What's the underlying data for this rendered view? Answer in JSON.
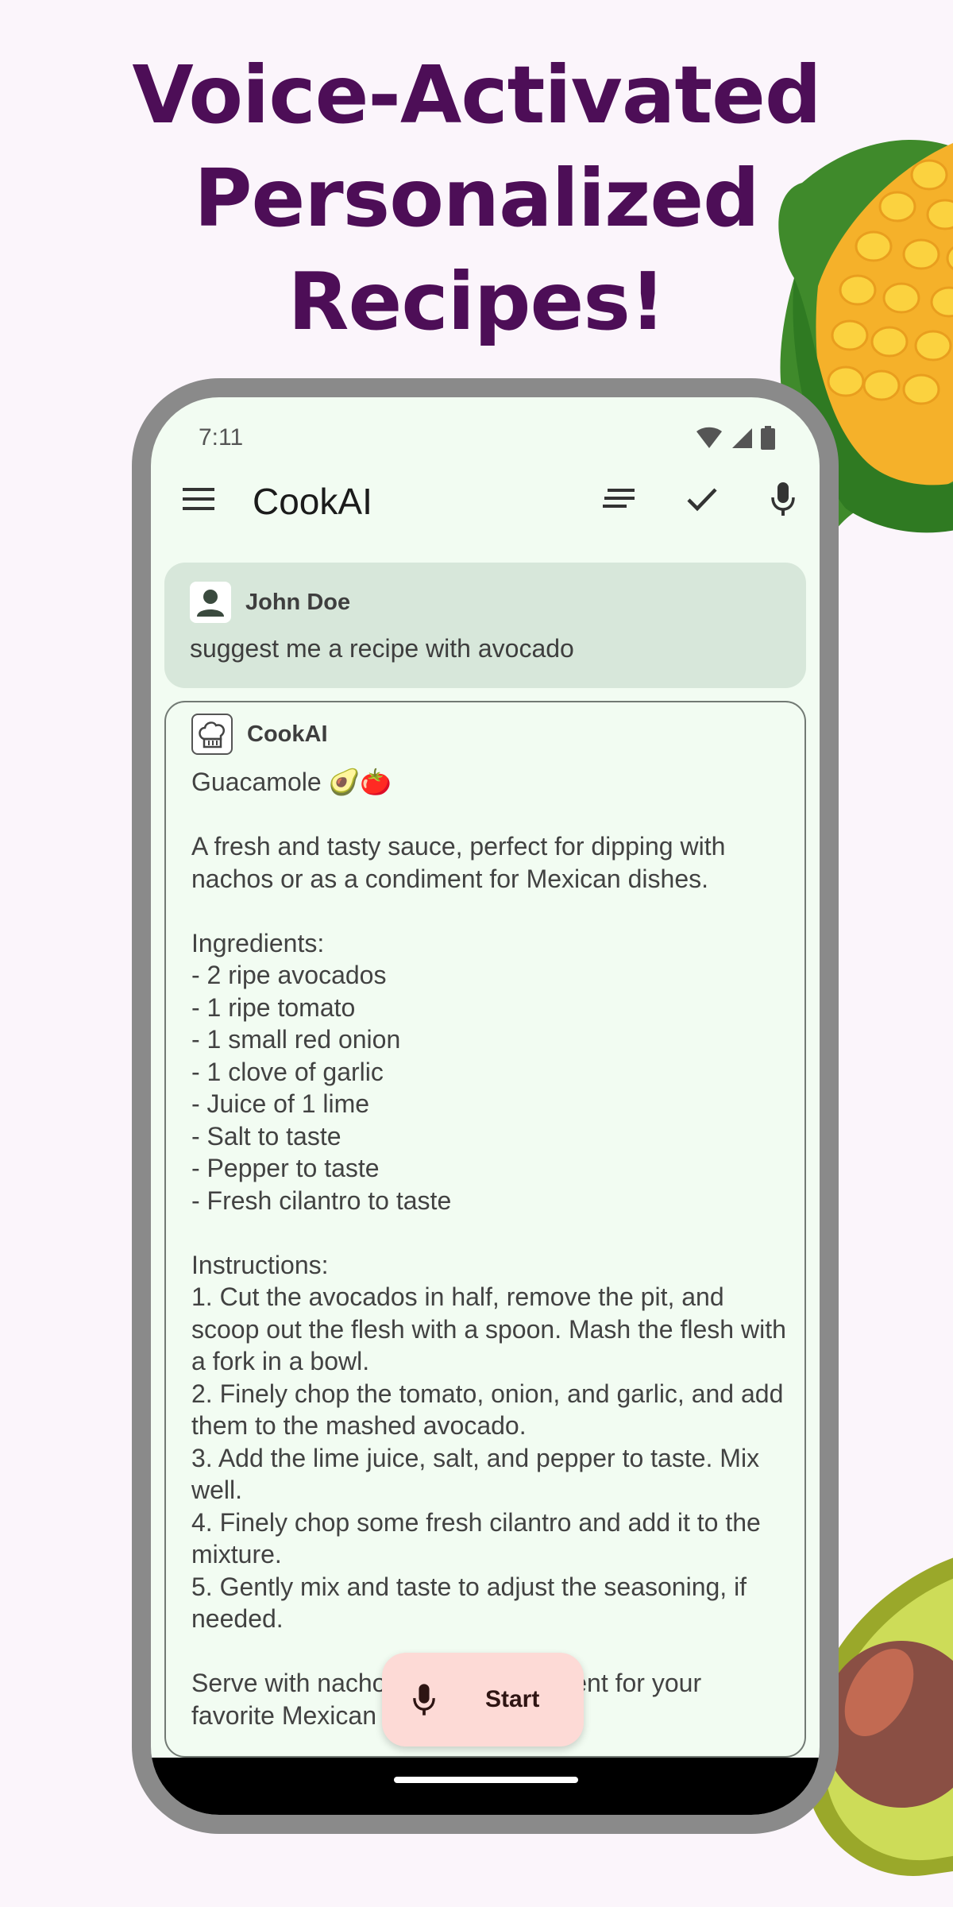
{
  "headline": [
    "Voice-Activated",
    "Personalized",
    "Recipes!"
  ],
  "status": {
    "time": "7:11"
  },
  "appbar": {
    "title": "CookAI",
    "icons": [
      "menu-icon",
      "sort-icon",
      "check-icon",
      "mic-icon"
    ]
  },
  "messages": {
    "user": {
      "name": "John Doe",
      "text": "suggest me a recipe with avocado"
    },
    "bot": {
      "name": "CookAI",
      "text": "Guacamole 🥑🍅\n\nA fresh and tasty sauce, perfect for dipping with nachos or as a condiment for Mexican dishes.\n\nIngredients:\n- 2 ripe avocados\n- 1 ripe tomato\n- 1 small red onion\n- 1 clove of garlic\n- Juice of 1 lime\n- Salt to taste\n- Pepper to taste\n- Fresh cilantro to taste\n\nInstructions:\n1. Cut the avocados in half, remove the pit, and scoop out the flesh with a spoon. Mash the flesh with a fork in a bowl.\n2. Finely chop the tomato, onion, and garlic, and add them to the mashed avocado.\n3. Add the lime juice, salt, and pepper to taste. Mix well.\n4. Finely chop some fresh cilantro and add it to the mixture.\n5. Gently mix and taste to adjust the seasoning, if needed.\n\nServe with nachos or as a condiment for your favorite Mexican dishes! 🥑🍅"
    }
  },
  "fab": {
    "label": "Start"
  },
  "colors": {
    "headline": "#4d0e57",
    "background": "#fbf5fb",
    "screen": "#f2fcf2",
    "user_bubble": "#d7e7da",
    "fab": "#fddad6"
  }
}
